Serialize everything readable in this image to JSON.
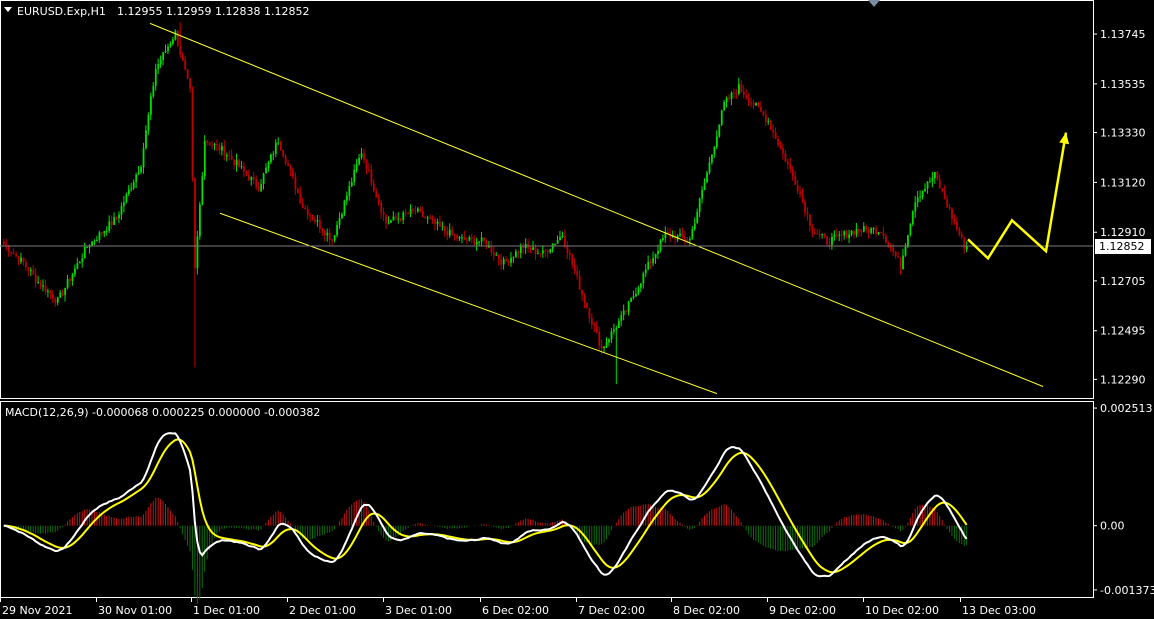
{
  "header": {
    "symbol": "EURUSD.Exp,H1",
    "ohlc": "1.12955 1.12959 1.12838 1.12852"
  },
  "macd_header": "MACD(12,26,9) -0.000068 0.000225 0.000000 -0.000382",
  "current_price": "1.12852",
  "colors": {
    "background": "#000000",
    "bull_candle": "#00e000",
    "bear_candle": "#c00000",
    "channel": "#ffff33",
    "arrow": "#ffff00",
    "macd_main": "#ffffff",
    "macd_signal": "#ffff00",
    "hist_pos": "#c81414",
    "hist_neg": "#0e6e0e",
    "grid_border": "#ffffff"
  },
  "chart_data": [
    {
      "type": "candlestick",
      "title": "EURUSD.Exp,H1",
      "y_ticks": [
        "1.13745",
        "1.13535",
        "1.13330",
        "1.13120",
        "1.12910",
        "1.12705",
        "1.12495",
        "1.12290"
      ],
      "ylim": [
        1.1222,
        1.1388
      ],
      "x_ticks": [
        "29 Nov 2021",
        "30 Nov 01:00",
        "1 Dec 01:00",
        "2 Dec 01:00",
        "3 Dec 01:00",
        "6 Dec 02:00",
        "7 Dec 02:00",
        "8 Dec 02:00",
        "9 Dec 02:00",
        "10 Dec 02:00",
        "13 Dec 03:00"
      ],
      "last_price": 1.12852,
      "key_closes": [
        [
          0,
          1.1286
        ],
        [
          8,
          1.1278
        ],
        [
          14,
          1.127
        ],
        [
          22,
          1.1262
        ],
        [
          34,
          1.1285
        ],
        [
          46,
          1.1297
        ],
        [
          56,
          1.132
        ],
        [
          62,
          1.136
        ],
        [
          70,
          1.1375
        ],
        [
          76,
          1.135
        ],
        [
          78,
          1.1275
        ],
        [
          82,
          1.133
        ],
        [
          90,
          1.1325
        ],
        [
          104,
          1.131
        ],
        [
          112,
          1.133
        ],
        [
          122,
          1.1302
        ],
        [
          134,
          1.1288
        ],
        [
          146,
          1.1325
        ],
        [
          156,
          1.1295
        ],
        [
          168,
          1.13
        ],
        [
          178,
          1.1293
        ],
        [
          186,
          1.1288
        ],
        [
          196,
          1.1287
        ],
        [
          204,
          1.1278
        ],
        [
          212,
          1.1285
        ],
        [
          220,
          1.1282
        ],
        [
          228,
          1.129
        ],
        [
          236,
          1.1265
        ],
        [
          244,
          1.1242
        ],
        [
          254,
          1.1258
        ],
        [
          262,
          1.1275
        ],
        [
          270,
          1.129
        ],
        [
          280,
          1.1288
        ],
        [
          288,
          1.132
        ],
        [
          294,
          1.1345
        ],
        [
          300,
          1.1352
        ],
        [
          312,
          1.1338
        ],
        [
          324,
          1.131
        ],
        [
          330,
          1.1292
        ],
        [
          336,
          1.1287
        ],
        [
          348,
          1.1292
        ],
        [
          358,
          1.1292
        ],
        [
          366,
          1.1277
        ],
        [
          372,
          1.1305
        ],
        [
          380,
          1.1315
        ],
        [
          388,
          1.1295
        ],
        [
          392,
          1.12852
        ]
      ],
      "channel": {
        "upper": [
          [
            150,
            1.1379
          ],
          [
            1043,
            1.1226
          ]
        ],
        "lower": [
          [
            220,
            1.1299
          ],
          [
            717,
            1.1223
          ]
        ]
      },
      "forecast_arrow": [
        [
          968,
          1.1288
        ],
        [
          988,
          1.128
        ],
        [
          1012,
          1.1296
        ],
        [
          1046,
          1.1283
        ],
        [
          1066,
          1.1333
        ]
      ]
    },
    {
      "type": "macd",
      "title": "MACD(12,26,9)",
      "params": [
        12,
        26,
        9
      ],
      "values": {
        "main": -6.8e-05,
        "signal": 0.000225,
        "histogram": 0.0,
        "extra": -0.000382
      },
      "y_ticks": [
        "0.002513",
        "0.00",
        "-0.001373"
      ],
      "ylim": [
        -0.00146,
        0.0026
      ]
    }
  ]
}
